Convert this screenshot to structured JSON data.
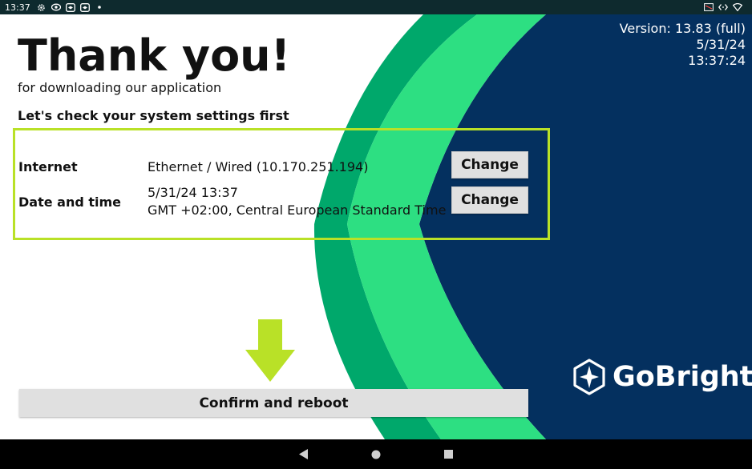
{
  "status_bar": {
    "time": "13:37"
  },
  "version": {
    "line1": "Version: 13.83 (full)",
    "line2": "5/31/24",
    "line3": "13:37:24"
  },
  "header": {
    "title": "Thank you!",
    "subtitle": "for downloading our application",
    "check_heading": "Let's check your system settings first"
  },
  "settings": {
    "internet": {
      "label": "Internet",
      "value": "Ethernet / Wired (10.170.251.194)",
      "button": "Change"
    },
    "datetime": {
      "label": "Date and time",
      "value_line1": "5/31/24 13:37",
      "value_line2": "GMT +02:00, Central European Standard Time",
      "button": "Change"
    }
  },
  "confirm_button": "Confirm and reboot",
  "logo": {
    "text": "GoBright"
  },
  "colors": {
    "navy": "#04305f",
    "green_dark": "#00a86b",
    "green_light": "#2ddf82",
    "highlight": "#b9e127"
  }
}
